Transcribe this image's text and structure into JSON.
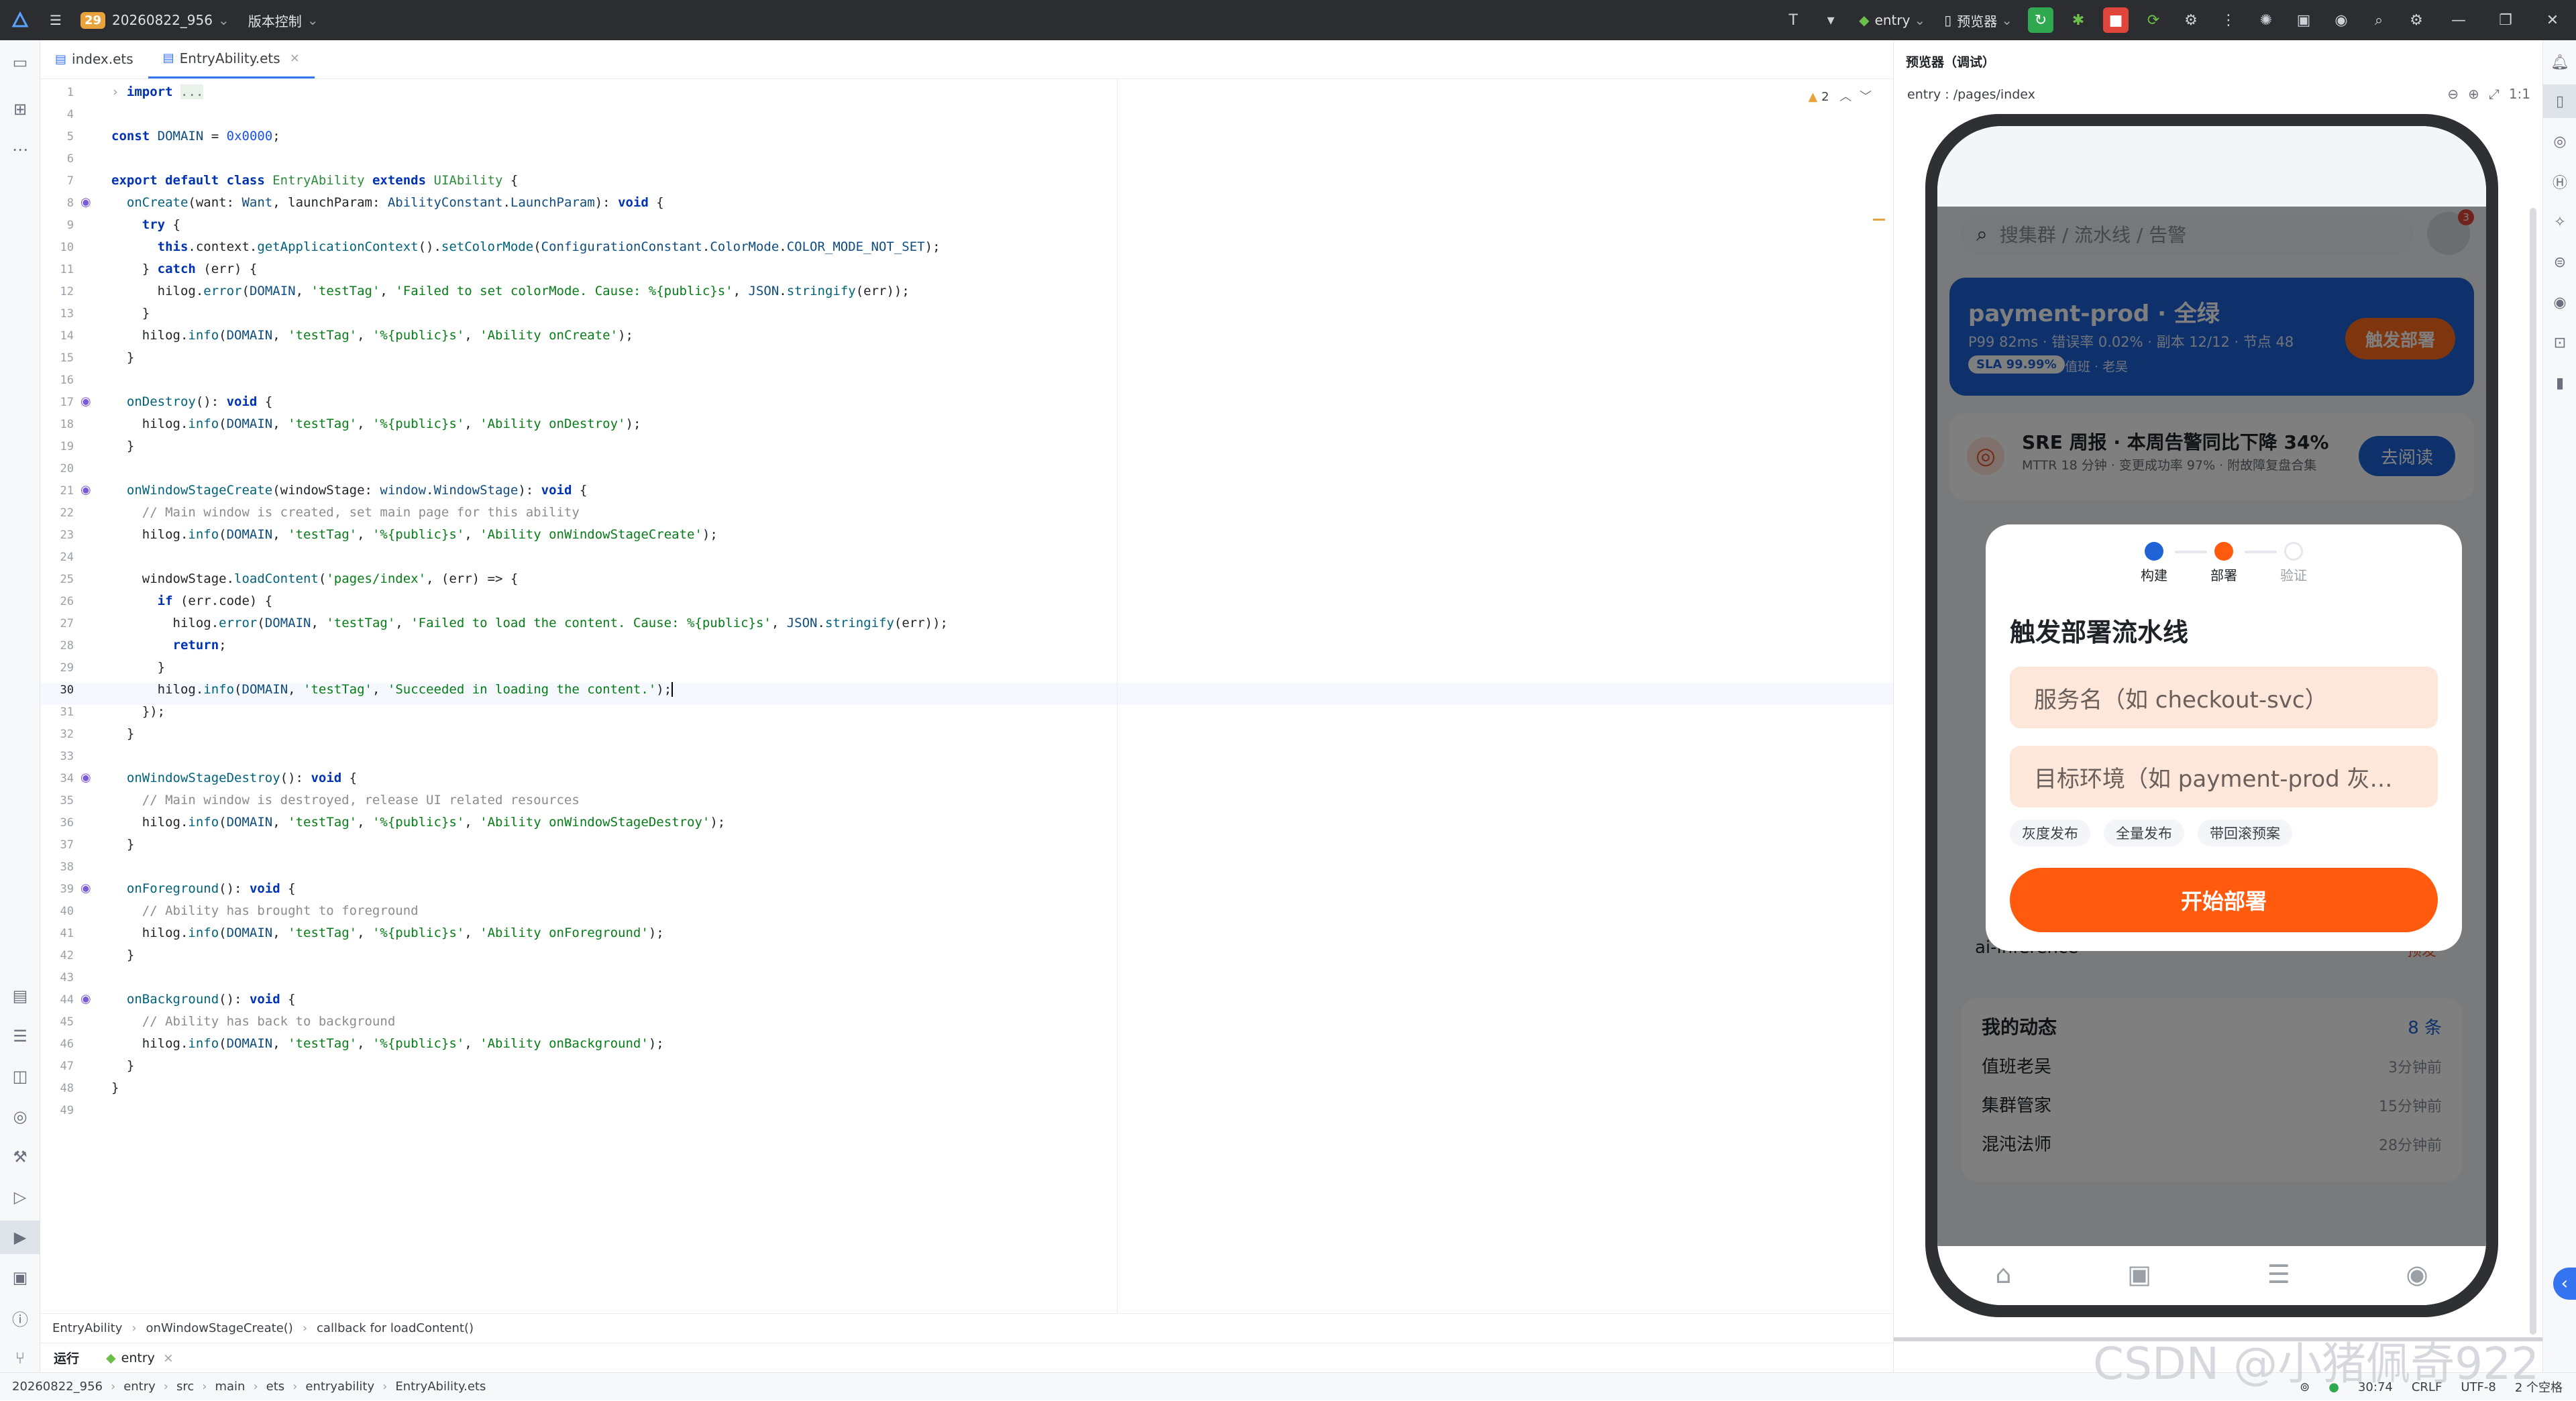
{
  "titlebar": {
    "project_badge": "29",
    "project_name": "20260822_956",
    "vcs": "版本控制",
    "run_config": "entry",
    "device": "预览器"
  },
  "tabs": [
    {
      "label": "index.ets"
    },
    {
      "label": "EntryAbility.ets"
    }
  ],
  "editor": {
    "warning_count": "2",
    "lines": [
      "1",
      "4",
      "5",
      "6",
      "7",
      "8",
      "9",
      "10",
      "11",
      "12",
      "13",
      "14",
      "15",
      "16",
      "17",
      "18",
      "19",
      "20",
      "21",
      "22",
      "23",
      "24",
      "25",
      "26",
      "27",
      "28",
      "29",
      "30",
      "31",
      "32",
      "33",
      "34",
      "35",
      "36",
      "37",
      "38",
      "39",
      "40",
      "41",
      "42",
      "43",
      "44",
      "45",
      "46",
      "47",
      "48",
      "49"
    ]
  },
  "breadcrumb": {
    "items": [
      "EntryAbility",
      "onWindowStageCreate()",
      "callback for loadContent()"
    ]
  },
  "runbar": {
    "label": "运行",
    "tab": "entry"
  },
  "statusbar": {
    "path": [
      "20260822_956",
      "entry",
      "src",
      "main",
      "ets",
      "entryability",
      "EntryAbility.ets"
    ],
    "position": "30:74",
    "line_sep": "CRLF",
    "encoding": "UTF-8",
    "indent": "2 个空格"
  },
  "preview": {
    "header": "预览器（调试）",
    "path": "entry : /pages/index",
    "zoom": "1:1"
  },
  "app": {
    "search_placeholder": "搜集群 / 流水线 / 告警",
    "notif_count": "3",
    "hero": {
      "title": "payment-prod · 全绿",
      "stats": "P99 82ms · 错误率 0.02% · 副本 12/12 · 节点 48",
      "sla": "SLA 99.99%",
      "oncall": "值班 · 老吴",
      "button": "触发部署"
    },
    "report": {
      "title": "SRE 周报 · 本周告警同比下降 34%",
      "subtitle": "MTTR 18 分钟 · 变更成功率 97% · 附故障复盘合集",
      "button": "去阅读"
    },
    "service_row": "ai-inference",
    "service_badge": "预发",
    "activity": {
      "title": "我的动态",
      "count": "8 条",
      "rows": [
        {
          "name": "值班老吴",
          "time": "3分钟前"
        },
        {
          "name": "集群管家",
          "time": "15分钟前"
        },
        {
          "name": "混沌法师",
          "time": "28分钟前"
        }
      ]
    },
    "dialog": {
      "steps": [
        "构建",
        "部署",
        "验证"
      ],
      "title": "触发部署流水线",
      "service_placeholder": "服务名（如 checkout-svc）",
      "env_placeholder": "目标环境（如 payment-prod 灰…",
      "chips": [
        "灰度发布",
        "全量发布",
        "带回滚预案"
      ],
      "start": "开始部署"
    }
  },
  "watermark": "CSDN @小猪佩奇922",
  "colors": {
    "accent": "#3574f0",
    "app_blue": "#1f63d6",
    "app_orange": "#ff5a0d"
  }
}
